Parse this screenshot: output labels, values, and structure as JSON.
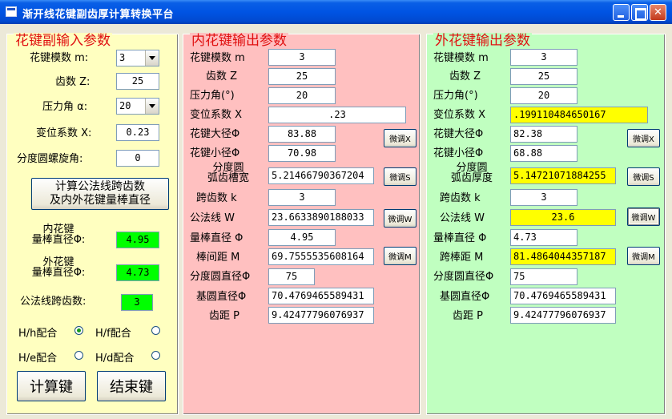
{
  "window": {
    "title": "渐开线花键副齿厚计算转换平台"
  },
  "input_panel": {
    "title": "花键副输入参数",
    "module_label": "花键模数 m:",
    "module_value": "3",
    "teeth_label": "齿数 Z:",
    "teeth_value": "25",
    "pressure_angle_label": "压力角 α:",
    "pressure_angle_value": "20",
    "shift_label": "变位系数 X:",
    "shift_value": "0.23",
    "helix_label": "分度圆螺旋角:",
    "helix_value": "0",
    "calc_button_line1": "计算公法线跨齿数",
    "calc_button_line2": "及内外花键量棒直径",
    "inner_rod_label_line1": "内花键",
    "inner_rod_label_line2": "量棒直径Φ:",
    "inner_rod_value": "4.95",
    "outer_rod_label_line1": "外花键",
    "outer_rod_label_line2": "量棒直径Φ:",
    "outer_rod_value": "4.73",
    "span_label": "公法线跨齿数:",
    "span_value": "3",
    "fits": [
      {
        "label": "H/h配合",
        "selected": true
      },
      {
        "label": "H/f配合",
        "selected": false
      },
      {
        "label": "H/e配合",
        "selected": false
      },
      {
        "label": "H/d配合",
        "selected": false
      }
    ],
    "compute_button": "计算键",
    "exit_button": "结束键"
  },
  "inner_panel": {
    "title": "内花键输出参数",
    "module_label": "花键模数 m",
    "module_value": "3",
    "teeth_label": "齿数 Z",
    "teeth_value": "25",
    "pressure_label": "压力角(°)",
    "pressure_value": "20",
    "shift_label": "变位系数 X",
    "shift_value": ".23",
    "major_label": "花键大径Φ",
    "major_value": "83.88",
    "minor_label": "花键小径Φ",
    "minor_value": "70.98",
    "space_label_line1": "分度圆",
    "space_label_line2": "弧齿槽宽",
    "space_value": "5.21466790367204",
    "span_label": "跨齿数 k",
    "span_value": "3",
    "wk_label": "公法线 W",
    "wk_value": "23.6633890188033",
    "rod_label": "量棒直径 Φ",
    "rod_value": "4.95",
    "between_label": "棒间距 M",
    "between_value": "69.7555535608164",
    "pitch_dia_label": "分度圆直径Φ",
    "pitch_dia_value": "75",
    "base_dia_label": "基圆直径Φ",
    "base_dia_value": "70.4769465589431",
    "pitch_label": "齿距 P",
    "pitch_value": "9.42477796076937",
    "adjust_x": "微调X",
    "adjust_s": "微调S",
    "adjust_w": "微调W",
    "adjust_m": "微调M"
  },
  "outer_panel": {
    "title": "外花键输出参数",
    "module_label": "花键模数 m",
    "module_value": "3",
    "teeth_label": "齿数 Z",
    "teeth_value": "25",
    "pressure_label": "压力角(°)",
    "pressure_value": "20",
    "shift_label": "变位系数 X",
    "shift_value": ".199110484650167",
    "major_label": "花键大径Φ",
    "major_value": "82.38",
    "minor_label": "花键小径Φ",
    "minor_value": "68.88",
    "thick_label_line1": "分度圆",
    "thick_label_line2": "弧齿厚度",
    "thick_value": "5.14721071884255",
    "span_label": "跨齿数 k",
    "span_value": "3",
    "wk_label": "公法线 W",
    "wk_value": "23.6",
    "rod_label": "量棒直径 Φ",
    "rod_value": "4.73",
    "span_m_label": "跨棒距 M",
    "span_m_value": "81.4864044357187",
    "pitch_dia_label": "分度圆直径Φ",
    "pitch_dia_value": "75",
    "base_dia_label": "基圆直径Φ",
    "base_dia_value": "70.4769465589431",
    "pitch_label": "齿距 P",
    "pitch_value": "9.42477796076937",
    "adjust_x": "微调X",
    "adjust_s": "微调S",
    "adjust_w": "微调W",
    "adjust_m": "微调M"
  },
  "colors": {
    "input_bg": "#ffffc0",
    "inner_bg": "#ffc0c0",
    "outer_bg": "#c0ffc0",
    "legend": "#e01010",
    "highlight": "#ffff00",
    "result": "#00ff00"
  }
}
